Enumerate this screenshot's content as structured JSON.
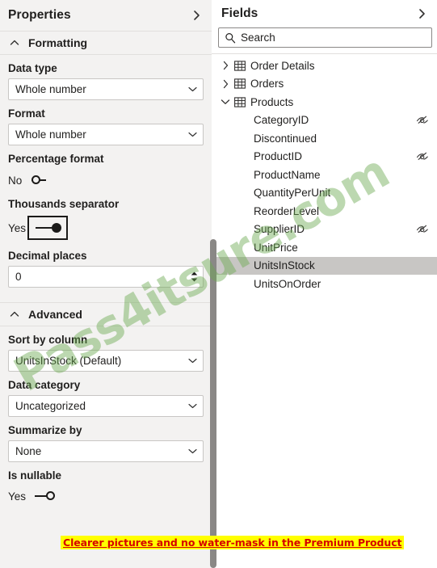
{
  "properties_pane": {
    "title": "Properties",
    "collapse_icon": "chevron-right-icon",
    "sections": [
      {
        "id": "formatting",
        "label": "Formatting",
        "caret_icon": "chevron-up-icon",
        "fields": {
          "data_type": {
            "label": "Data type",
            "value": "Whole number",
            "icon": "chevron-down-icon"
          },
          "format": {
            "label": "Format",
            "value": "Whole number",
            "icon": "chevron-down-icon"
          },
          "percentage_format": {
            "label": "Percentage format",
            "state": "No",
            "on": false
          },
          "thousands_separator": {
            "label": "Thousands separator",
            "state": "Yes",
            "on": true,
            "focused": true
          },
          "decimal_places": {
            "label": "Decimal places",
            "value": "0",
            "spinner_icon": "spinner-arrows-icon"
          }
        }
      },
      {
        "id": "advanced",
        "label": "Advanced",
        "caret_icon": "chevron-up-icon",
        "fields": {
          "sort_by_column": {
            "label": "Sort by column",
            "value": "UnitsInStock (Default)",
            "icon": "chevron-down-icon"
          },
          "data_category": {
            "label": "Data category",
            "value": "Uncategorized",
            "icon": "chevron-down-icon"
          },
          "summarize_by": {
            "label": "Summarize by",
            "value": "None",
            "icon": "chevron-down-icon"
          },
          "is_nullable": {
            "label": "Is nullable",
            "state": "Yes",
            "on": false
          }
        }
      }
    ]
  },
  "fields_pane": {
    "title": "Fields",
    "collapse_icon": "chevron-right-icon",
    "search": {
      "placeholder": "Search",
      "value": "",
      "icon": "search-icon"
    },
    "tables": [
      {
        "name": "Order Details",
        "expanded": false,
        "chevron_icon": "chevron-right-icon",
        "table_icon": "table-icon",
        "columns": []
      },
      {
        "name": "Orders",
        "expanded": false,
        "chevron_icon": "chevron-right-icon",
        "table_icon": "table-icon",
        "columns": []
      },
      {
        "name": "Products",
        "expanded": true,
        "chevron_icon": "chevron-down-icon",
        "table_icon": "table-icon",
        "columns": [
          {
            "name": "CategoryID",
            "hidden": true,
            "selected": false
          },
          {
            "name": "Discontinued",
            "hidden": false,
            "selected": false
          },
          {
            "name": "ProductID",
            "hidden": true,
            "selected": false
          },
          {
            "name": "ProductName",
            "hidden": false,
            "selected": false
          },
          {
            "name": "QuantityPerUnit",
            "hidden": false,
            "selected": false
          },
          {
            "name": "ReorderLevel",
            "hidden": false,
            "selected": false
          },
          {
            "name": "SupplierID",
            "hidden": true,
            "selected": false
          },
          {
            "name": "UnitPrice",
            "hidden": false,
            "selected": false
          },
          {
            "name": "UnitsInStock",
            "hidden": false,
            "selected": true
          },
          {
            "name": "UnitsOnOrder",
            "hidden": false,
            "selected": false
          }
        ]
      }
    ]
  },
  "overlays": {
    "watermark_text": "Pass4itsure.com",
    "promo_text": "Clearer pictures and no water-mask in the Premium Product"
  },
  "colors": {
    "pane_background": "#f3f2f1",
    "selection": "#c8c6c4",
    "text": "#201f1e",
    "border": "#c8c6c4",
    "scrollbar": "#8a8886",
    "watermark": "#6aa84f",
    "promo_background": "#ffff00",
    "promo_text_color": "#d60000"
  }
}
